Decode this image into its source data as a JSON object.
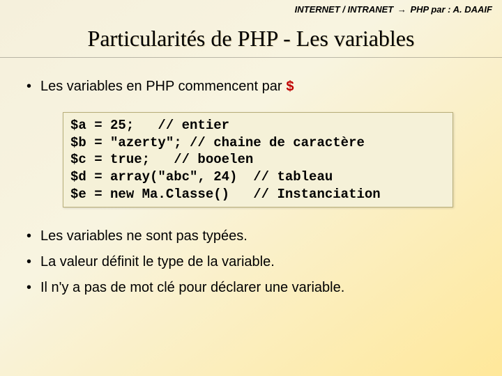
{
  "header": {
    "left": "INTERNET / INTRANET",
    "arrow": "→",
    "mid": "PHP par :",
    "author": "A. DAAIF"
  },
  "title": "Particularités de PHP - Les variables",
  "bullet_intro": {
    "text": "Les variables en PHP commencent par ",
    "symbol": "$"
  },
  "code_lines": [
    "$a = 25;   // entier",
    "$b = \"azerty\"; // chaine de caractère",
    "$c = true;   // booelen",
    "$d = array(\"abc\", 24)  // tableau",
    "$e = new Ma.Classe()   // Instanciation"
  ],
  "bullets_after": [
    "Les variables ne sont pas typées.",
    "La valeur définit le type de la variable.",
    "Il n'y a pas de mot clé pour déclarer une variable."
  ]
}
